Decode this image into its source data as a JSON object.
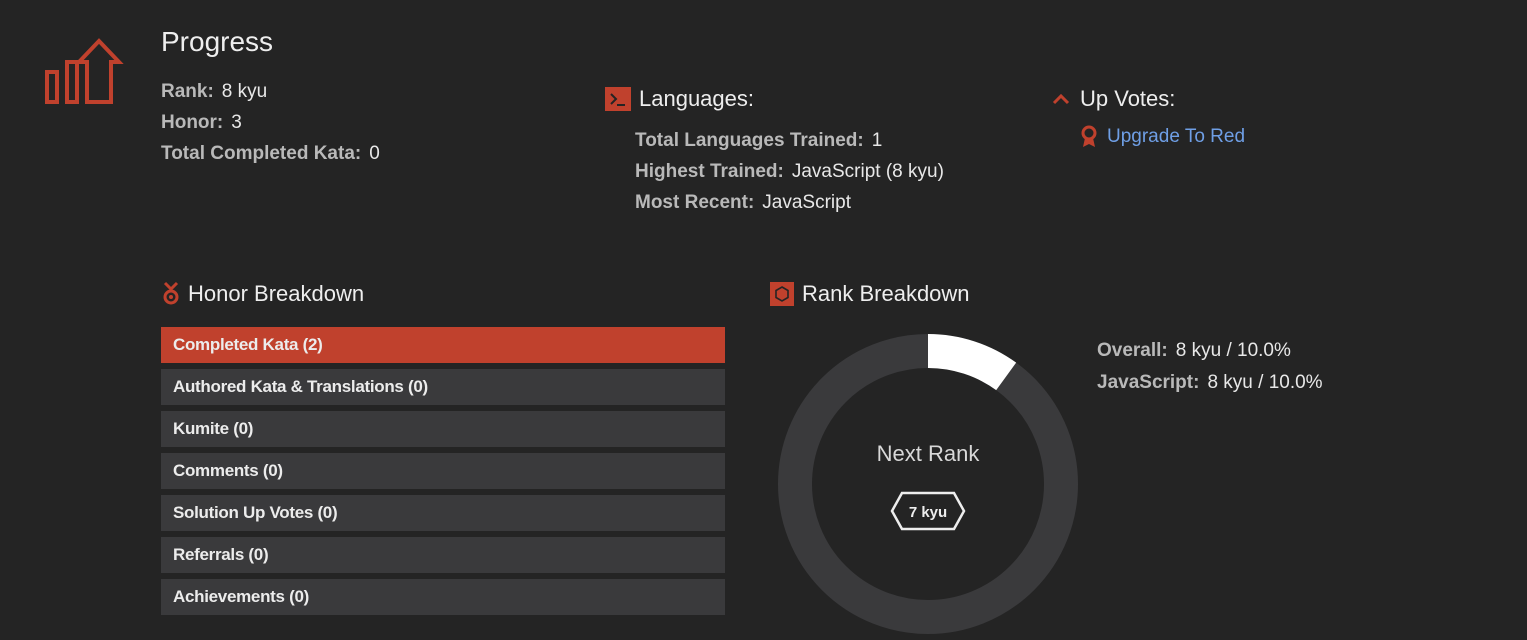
{
  "progress": {
    "title": "Progress",
    "rank_label": "Rank:",
    "rank_value": "8 kyu",
    "honor_label": "Honor:",
    "honor_value": "3",
    "completed_label": "Total Completed Kata:",
    "completed_value": "0",
    "icon": "bar-chart-arrow-icon"
  },
  "languages": {
    "title": "Languages:",
    "icon": "terminal-icon",
    "total_label": "Total Languages Trained:",
    "total_value": "1",
    "highest_label": "Highest Trained:",
    "highest_value": "JavaScript (8 kyu)",
    "recent_label": "Most Recent:",
    "recent_value": "JavaScript"
  },
  "up_votes": {
    "title": "Up Votes:",
    "icon": "chevron-up-icon",
    "link_icon": "ribbon-icon",
    "link_label": "Upgrade To Red"
  },
  "honor_breakdown": {
    "title": "Honor Breakdown",
    "icon": "medal-icon",
    "items": [
      {
        "label": "Completed Kata (2)"
      },
      {
        "label": "Authored Kata & Translations (0)"
      },
      {
        "label": "Kumite (0)"
      },
      {
        "label": "Comments (0)"
      },
      {
        "label": "Solution Up Votes (0)"
      },
      {
        "label": "Referrals (0)"
      },
      {
        "label": "Achievements (0)"
      }
    ]
  },
  "rank_breakdown": {
    "title": "Rank Breakdown",
    "icon": "hexagon-icon",
    "next_rank_label": "Next Rank",
    "next_rank_badge": "7 kyu",
    "progress_fraction": 0.1,
    "overall_label": "Overall:",
    "overall_value": "8 kyu / 10.0%",
    "js_label": "JavaScript:",
    "js_value": "8 kyu / 10.0%"
  },
  "colors": {
    "accent": "#c0412d",
    "background": "#242424",
    "ring_track": "#3a3a3c",
    "ring_fill": "#ffffff",
    "link": "#6f9fe6"
  }
}
